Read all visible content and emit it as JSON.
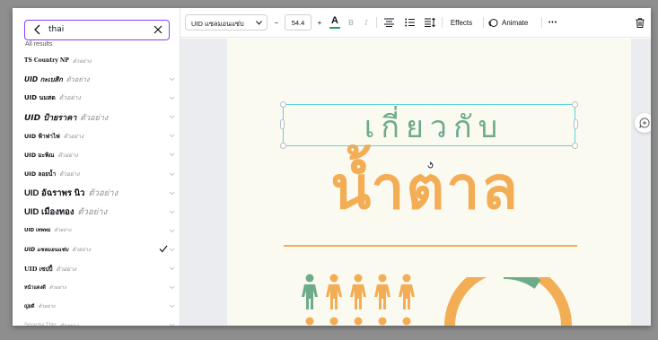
{
  "search": {
    "value": "thai",
    "results_label": "All results"
  },
  "fonts": [
    {
      "name": "TS Country NP",
      "sample": "ตัวอย่าง",
      "selected": false
    },
    {
      "name": "UID กะเบสิก",
      "sample": "ตัวอย่าง",
      "selected": false
    },
    {
      "name": "UID นมสด",
      "sample": "ตัวอย่าง",
      "selected": false
    },
    {
      "name": "UID ป้ายราคา",
      "sample": "ตัวอย่าง",
      "selected": false
    },
    {
      "name": "UID ฟ้าฟาไฟ",
      "sample": "ตัวอย่าง",
      "selected": false
    },
    {
      "name": "UID มะพิณ",
      "sample": "ตัวอย่าง",
      "selected": false
    },
    {
      "name": "UID ลอยน้ำ",
      "sample": "ตัวอย่าง",
      "selected": false
    },
    {
      "name": "UID อัฉราพร นิว",
      "sample": "ตัวอย่าง",
      "selected": false
    },
    {
      "name": "UID เมืองทอง",
      "sample": "ตัวอย่าง",
      "selected": false
    },
    {
      "name": "UID เทพพม",
      "sample": "ตัวอย่าง",
      "selected": false
    },
    {
      "name": "UID แซลมอนแซ่บ",
      "sample": "ตัวอย่าง",
      "selected": true
    },
    {
      "name": "UID เซปปี้",
      "sample": "ตัวอย่าง",
      "selected": false
    },
    {
      "name": "หน้าแดงดี",
      "sample": "ตัวอย่าง",
      "selected": false
    },
    {
      "name": "ญ่ยดี",
      "sample": "ตัวอย่าง",
      "selected": false
    },
    {
      "name": "Sriracha Thin",
      "sample": "ตัวอย่าง",
      "selected": false
    }
  ],
  "toolbar": {
    "font_name": "UID แซลมอนแซ่บ",
    "minus": "−",
    "font_size": "54.4",
    "plus": "+",
    "text_color_letter": "A",
    "bold": "B",
    "italic": "I",
    "effects": "Effects",
    "animate": "Animate",
    "more": "•••"
  },
  "canvas": {
    "heading_line1": "เกี่ยวกับ",
    "heading_line2": "น้ำตาล"
  },
  "colors": {
    "accent_purple": "#8b3dff",
    "selection": "#5ad6dc",
    "green": "#6dab8b",
    "orange": "#f3ad55",
    "page_bg": "#fbfaf0",
    "text_color_underline": "#1fa35b"
  },
  "icons": {
    "back": "chevron-left-icon",
    "clear": "close-icon",
    "expand": "chevron-down-icon",
    "check": "check-icon",
    "align": "align-center-icon",
    "list": "bullet-list-icon",
    "spacing": "line-spacing-icon",
    "animate": "animate-icon",
    "delete": "trash-icon",
    "comment": "add-comment-icon"
  }
}
